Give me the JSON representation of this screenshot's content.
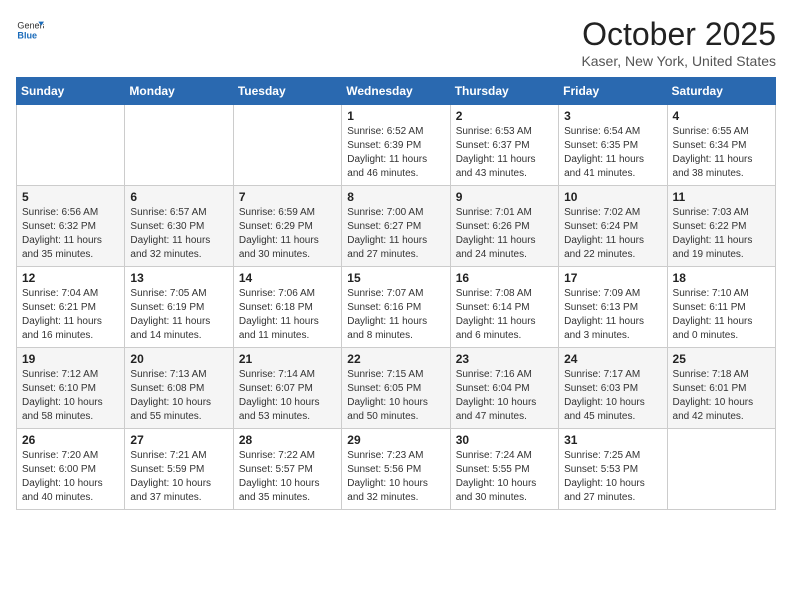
{
  "header": {
    "logo_general": "General",
    "logo_blue": "Blue",
    "title": "October 2025",
    "subtitle": "Kaser, New York, United States"
  },
  "days_of_week": [
    "Sunday",
    "Monday",
    "Tuesday",
    "Wednesday",
    "Thursday",
    "Friday",
    "Saturday"
  ],
  "weeks": [
    [
      {
        "day": "",
        "info": ""
      },
      {
        "day": "",
        "info": ""
      },
      {
        "day": "",
        "info": ""
      },
      {
        "day": "1",
        "info": "Sunrise: 6:52 AM\nSunset: 6:39 PM\nDaylight: 11 hours\nand 46 minutes."
      },
      {
        "day": "2",
        "info": "Sunrise: 6:53 AM\nSunset: 6:37 PM\nDaylight: 11 hours\nand 43 minutes."
      },
      {
        "day": "3",
        "info": "Sunrise: 6:54 AM\nSunset: 6:35 PM\nDaylight: 11 hours\nand 41 minutes."
      },
      {
        "day": "4",
        "info": "Sunrise: 6:55 AM\nSunset: 6:34 PM\nDaylight: 11 hours\nand 38 minutes."
      }
    ],
    [
      {
        "day": "5",
        "info": "Sunrise: 6:56 AM\nSunset: 6:32 PM\nDaylight: 11 hours\nand 35 minutes."
      },
      {
        "day": "6",
        "info": "Sunrise: 6:57 AM\nSunset: 6:30 PM\nDaylight: 11 hours\nand 32 minutes."
      },
      {
        "day": "7",
        "info": "Sunrise: 6:59 AM\nSunset: 6:29 PM\nDaylight: 11 hours\nand 30 minutes."
      },
      {
        "day": "8",
        "info": "Sunrise: 7:00 AM\nSunset: 6:27 PM\nDaylight: 11 hours\nand 27 minutes."
      },
      {
        "day": "9",
        "info": "Sunrise: 7:01 AM\nSunset: 6:26 PM\nDaylight: 11 hours\nand 24 minutes."
      },
      {
        "day": "10",
        "info": "Sunrise: 7:02 AM\nSunset: 6:24 PM\nDaylight: 11 hours\nand 22 minutes."
      },
      {
        "day": "11",
        "info": "Sunrise: 7:03 AM\nSunset: 6:22 PM\nDaylight: 11 hours\nand 19 minutes."
      }
    ],
    [
      {
        "day": "12",
        "info": "Sunrise: 7:04 AM\nSunset: 6:21 PM\nDaylight: 11 hours\nand 16 minutes."
      },
      {
        "day": "13",
        "info": "Sunrise: 7:05 AM\nSunset: 6:19 PM\nDaylight: 11 hours\nand 14 minutes."
      },
      {
        "day": "14",
        "info": "Sunrise: 7:06 AM\nSunset: 6:18 PM\nDaylight: 11 hours\nand 11 minutes."
      },
      {
        "day": "15",
        "info": "Sunrise: 7:07 AM\nSunset: 6:16 PM\nDaylight: 11 hours\nand 8 minutes."
      },
      {
        "day": "16",
        "info": "Sunrise: 7:08 AM\nSunset: 6:14 PM\nDaylight: 11 hours\nand 6 minutes."
      },
      {
        "day": "17",
        "info": "Sunrise: 7:09 AM\nSunset: 6:13 PM\nDaylight: 11 hours\nand 3 minutes."
      },
      {
        "day": "18",
        "info": "Sunrise: 7:10 AM\nSunset: 6:11 PM\nDaylight: 11 hours\nand 0 minutes."
      }
    ],
    [
      {
        "day": "19",
        "info": "Sunrise: 7:12 AM\nSunset: 6:10 PM\nDaylight: 10 hours\nand 58 minutes."
      },
      {
        "day": "20",
        "info": "Sunrise: 7:13 AM\nSunset: 6:08 PM\nDaylight: 10 hours\nand 55 minutes."
      },
      {
        "day": "21",
        "info": "Sunrise: 7:14 AM\nSunset: 6:07 PM\nDaylight: 10 hours\nand 53 minutes."
      },
      {
        "day": "22",
        "info": "Sunrise: 7:15 AM\nSunset: 6:05 PM\nDaylight: 10 hours\nand 50 minutes."
      },
      {
        "day": "23",
        "info": "Sunrise: 7:16 AM\nSunset: 6:04 PM\nDaylight: 10 hours\nand 47 minutes."
      },
      {
        "day": "24",
        "info": "Sunrise: 7:17 AM\nSunset: 6:03 PM\nDaylight: 10 hours\nand 45 minutes."
      },
      {
        "day": "25",
        "info": "Sunrise: 7:18 AM\nSunset: 6:01 PM\nDaylight: 10 hours\nand 42 minutes."
      }
    ],
    [
      {
        "day": "26",
        "info": "Sunrise: 7:20 AM\nSunset: 6:00 PM\nDaylight: 10 hours\nand 40 minutes."
      },
      {
        "day": "27",
        "info": "Sunrise: 7:21 AM\nSunset: 5:59 PM\nDaylight: 10 hours\nand 37 minutes."
      },
      {
        "day": "28",
        "info": "Sunrise: 7:22 AM\nSunset: 5:57 PM\nDaylight: 10 hours\nand 35 minutes."
      },
      {
        "day": "29",
        "info": "Sunrise: 7:23 AM\nSunset: 5:56 PM\nDaylight: 10 hours\nand 32 minutes."
      },
      {
        "day": "30",
        "info": "Sunrise: 7:24 AM\nSunset: 5:55 PM\nDaylight: 10 hours\nand 30 minutes."
      },
      {
        "day": "31",
        "info": "Sunrise: 7:25 AM\nSunset: 5:53 PM\nDaylight: 10 hours\nand 27 minutes."
      },
      {
        "day": "",
        "info": ""
      }
    ]
  ]
}
